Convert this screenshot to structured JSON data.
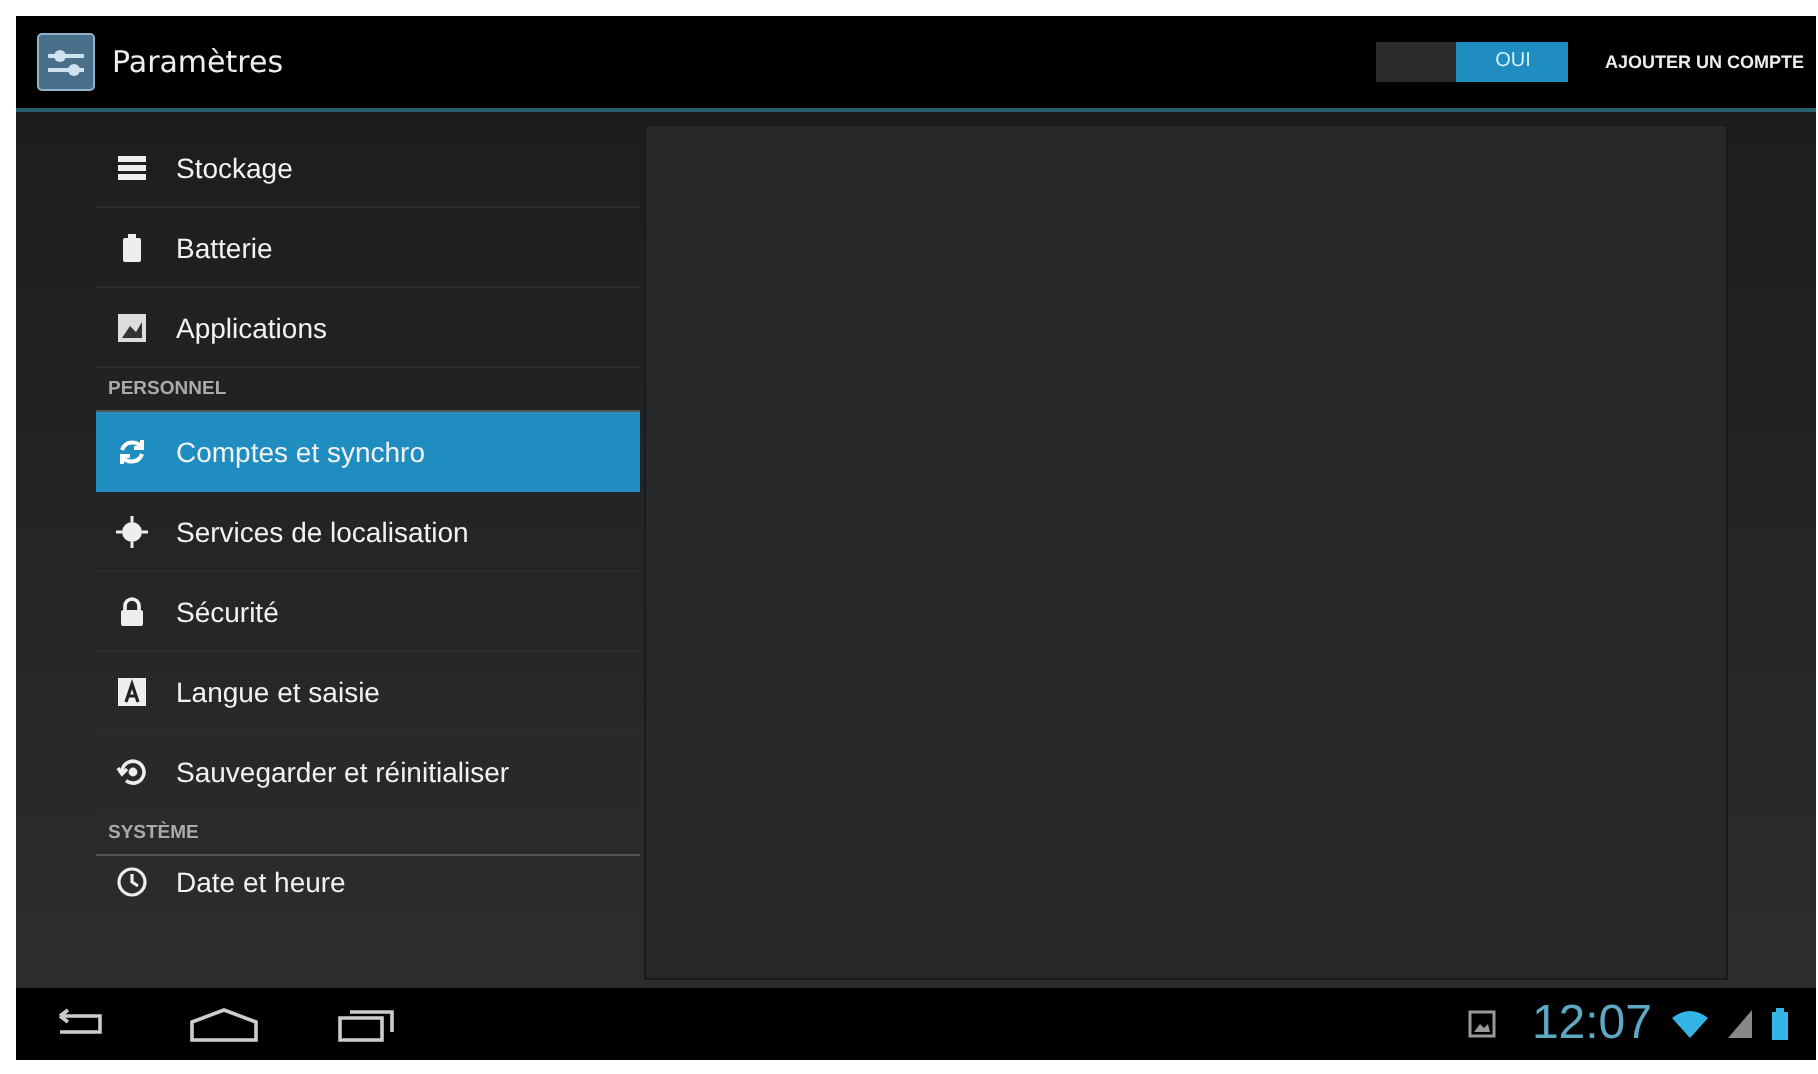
{
  "action_bar": {
    "title": "Paramètres",
    "toggle": {
      "label": "OUI",
      "on": true
    },
    "action": "AJOUTER UN COMPTE"
  },
  "sidebar": {
    "items": [
      {
        "kind": "item",
        "label": "Stockage",
        "selected": false
      },
      {
        "kind": "item",
        "label": "Batterie",
        "selected": false
      },
      {
        "kind": "item",
        "label": "Applications",
        "selected": false
      },
      {
        "kind": "header",
        "label": "PERSONNEL"
      },
      {
        "kind": "item",
        "label": "Comptes et synchro",
        "selected": true
      },
      {
        "kind": "item",
        "label": "Services de localisation",
        "selected": false
      },
      {
        "kind": "item",
        "label": "Sécurité",
        "selected": false
      },
      {
        "kind": "item",
        "label": "Langue et saisie",
        "selected": false
      },
      {
        "kind": "item",
        "label": "Sauvegarder et réinitialiser",
        "selected": false
      },
      {
        "kind": "header",
        "label": "SYSTÈME"
      },
      {
        "kind": "item",
        "label": "Date et heure",
        "selected": false
      }
    ]
  },
  "status_bar": {
    "time": "12:07"
  }
}
